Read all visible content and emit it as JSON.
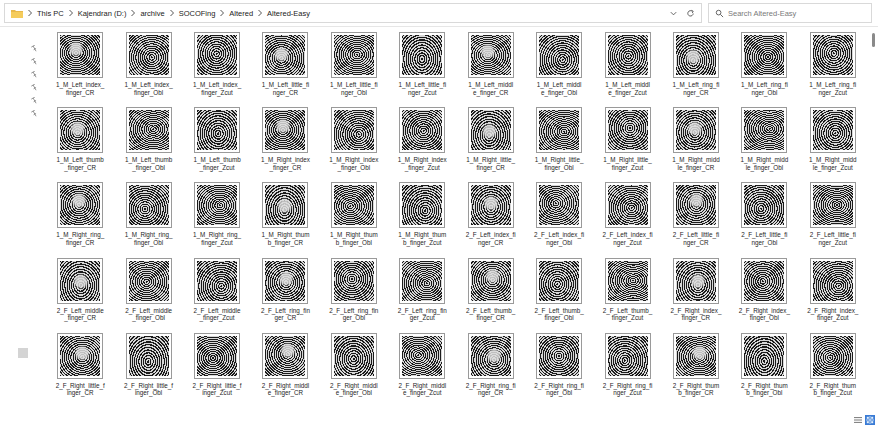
{
  "address_bar": {
    "segments": [
      "This PC",
      "Kajendran (D:)",
      "archive",
      "SOCOFing",
      "Altered",
      "Altered-Easy"
    ]
  },
  "search": {
    "placeholder": "Search Altered-Easy"
  },
  "files": [
    {
      "lines": [
        "1_M_Left_index_",
        "finger_CR"
      ],
      "selected": false
    },
    {
      "lines": [
        "1_M_Left_index_",
        "finger_Obl"
      ],
      "selected": false
    },
    {
      "lines": [
        "1_M_Left_index_",
        "finger_Zcut"
      ],
      "selected": false
    },
    {
      "lines": [
        "1_M_Left_little_fi",
        "nger_CR"
      ],
      "selected": false
    },
    {
      "lines": [
        "1_M_Left_little_fi",
        "nger_Obl"
      ],
      "selected": false
    },
    {
      "lines": [
        "1_M_Left_little_fi",
        "nger_Zcut"
      ],
      "selected": false
    },
    {
      "lines": [
        "1_M_Left_middl",
        "e_finger_CR"
      ],
      "selected": false
    },
    {
      "lines": [
        "1_M_Left_middl",
        "e_finger_Obl"
      ],
      "selected": false
    },
    {
      "lines": [
        "1_M_Left_middl",
        "e_finger_Zcut"
      ],
      "selected": false
    },
    {
      "lines": [
        "1_M_Left_ring_fi",
        "nger_CR"
      ],
      "selected": false
    },
    {
      "lines": [
        "1_M_Left_ring_fi",
        "nger_Obl"
      ],
      "selected": false
    },
    {
      "lines": [
        "1_M_Left_ring_fi",
        "nger_Zcut"
      ],
      "selected": false
    },
    {
      "lines": [
        "1_M_Left_thumb",
        "_finger_CR"
      ],
      "selected": false
    },
    {
      "lines": [
        "1_M_Left_thumb",
        "_finger_Obl"
      ],
      "selected": false
    },
    {
      "lines": [
        "1_M_Left_thumb",
        "_finger_Zcut"
      ],
      "selected": false
    },
    {
      "lines": [
        "1_M_Right_index",
        "_finger_CR"
      ],
      "selected": false
    },
    {
      "lines": [
        "1_M_Right_index",
        "_finger_Obl"
      ],
      "selected": false
    },
    {
      "lines": [
        "1_M_Right_index",
        "_finger_Zcut"
      ],
      "selected": false
    },
    {
      "lines": [
        "1_M_Right_little_",
        "finger_CR"
      ],
      "selected": false
    },
    {
      "lines": [
        "1_M_Right_little_",
        "finger_Obl"
      ],
      "selected": false
    },
    {
      "lines": [
        "1_M_Right_little_",
        "finger_Zcut"
      ],
      "selected": false
    },
    {
      "lines": [
        "1_M_Right_midd",
        "le_finger_CR"
      ],
      "selected": false
    },
    {
      "lines": [
        "1_M_Right_midd",
        "le_finger_Obl"
      ],
      "selected": false
    },
    {
      "lines": [
        "1_M_Right_midd",
        "le_finger_Zcut"
      ],
      "selected": false
    },
    {
      "lines": [
        "1_M_Right_ring_",
        "finger_CR"
      ],
      "selected": false
    },
    {
      "lines": [
        "1_M_Right_ring_",
        "finger_Obl"
      ],
      "selected": false
    },
    {
      "lines": [
        "1_M_Right_ring_",
        "finger_Zcut"
      ],
      "selected": false
    },
    {
      "lines": [
        "1_M_Right_thum",
        "b_finger_CR"
      ],
      "selected": false
    },
    {
      "lines": [
        "1_M_Right_thum",
        "b_finger_Obl"
      ],
      "selected": false
    },
    {
      "lines": [
        "1_M_Right_thum",
        "b_finger_Zcut"
      ],
      "selected": false
    },
    {
      "lines": [
        "2_F_Left_index_fi",
        "nger_CR"
      ],
      "selected": false
    },
    {
      "lines": [
        "2_F_Left_index_fi",
        "nger_Obl"
      ],
      "selected": false
    },
    {
      "lines": [
        "2_F_Left_index_fi",
        "nger_Zcut"
      ],
      "selected": false
    },
    {
      "lines": [
        "2_F_Left_little_fi",
        "nger_CR"
      ],
      "selected": false
    },
    {
      "lines": [
        "2_F_Left_little_fi",
        "nger_Obl"
      ],
      "selected": false
    },
    {
      "lines": [
        "2_F_Left_little_fi",
        "nger_Zcut"
      ],
      "selected": false
    },
    {
      "lines": [
        "2_F_Left_middle",
        "_finger_CR"
      ],
      "selected": false
    },
    {
      "lines": [
        "2_F_Left_middle",
        "_finger_Obl"
      ],
      "selected": false
    },
    {
      "lines": [
        "2_F_Left_middle",
        "_finger_Zcut"
      ],
      "selected": false
    },
    {
      "lines": [
        "2_F_Left_ring_fin",
        "ger_CR"
      ],
      "selected": false
    },
    {
      "lines": [
        "2_F_Left_ring_fin",
        "ger_Obl"
      ],
      "selected": false
    },
    {
      "lines": [
        "2_F_Left_ring_fin",
        "ger_Zcut"
      ],
      "selected": false
    },
    {
      "lines": [
        "2_F_Left_thumb_",
        "finger_CR"
      ],
      "selected": false
    },
    {
      "lines": [
        "2_F_Left_thumb_",
        "finger_Obl"
      ],
      "selected": false
    },
    {
      "lines": [
        "2_F_Left_thumb_",
        "finger_Zcut"
      ],
      "selected": false
    },
    {
      "lines": [
        "2_F_Right_index_",
        "finger_CR"
      ],
      "selected": false
    },
    {
      "lines": [
        "2_F_Right_index_",
        "finger_Obl"
      ],
      "selected": false
    },
    {
      "lines": [
        "2_F_Right_index_",
        "finger_Zcut"
      ],
      "selected": false
    },
    {
      "lines": [
        "2_F_Right_little_f",
        "inger_CR"
      ],
      "selected": false
    },
    {
      "lines": [
        "2_F_Right_little_f",
        "inger_Obl"
      ],
      "selected": false
    },
    {
      "lines": [
        "2_F_Right_little_f",
        "inger_Zcut"
      ],
      "selected": false
    },
    {
      "lines": [
        "2_F_Right_middl",
        "e_finger_CR"
      ],
      "selected": false
    },
    {
      "lines": [
        "2_F_Right_middl",
        "e_finger_Obl"
      ],
      "selected": false
    },
    {
      "lines": [
        "2_F_Right_middl",
        "e_finger_Zcut"
      ],
      "selected": false
    },
    {
      "lines": [
        "2_F_Right_ring_fi",
        "nger_CR"
      ],
      "selected": false
    },
    {
      "lines": [
        "2_F_Right_ring_fi",
        "nger_Obl"
      ],
      "selected": false
    },
    {
      "lines": [
        "2_F_Right_ring_fi",
        "nger_Zcut"
      ],
      "selected": false
    },
    {
      "lines": [
        "2_F_Right_thum",
        "b_finger_CR"
      ],
      "selected": false
    },
    {
      "lines": [
        "2_F_Right_thum",
        "b_finger_Obl"
      ],
      "selected": false
    },
    {
      "lines": [
        "2_F_Right_thum",
        "b_finger_Zcut"
      ],
      "selected": false
    }
  ],
  "view_buttons": [
    {
      "kind": "details",
      "selected": false
    },
    {
      "kind": "thumbnails",
      "selected": true
    }
  ]
}
